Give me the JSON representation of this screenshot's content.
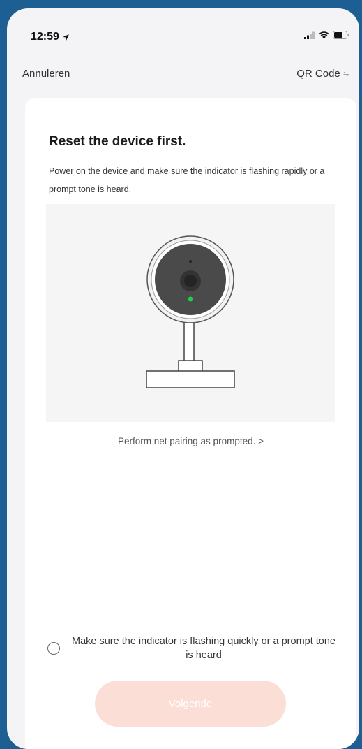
{
  "status_bar": {
    "time": "12:59"
  },
  "nav": {
    "cancel_label": "Annuleren",
    "qr_label": "QR Code"
  },
  "card": {
    "title": "Reset the device first.",
    "description": "Power on the device and make sure the indicator is flashing rapidly or a prompt tone is heard.",
    "pairing_link": "Perform net pairing as prompted. >",
    "confirm_text": "Make sure the indicator is flashing quickly or a prompt tone is heard",
    "confirm_checked": false,
    "next_label": "Volgende"
  },
  "colors": {
    "background": "#1d5f93",
    "screen": "#f4f4f6",
    "card": "#ffffff",
    "button_disabled": "#fbdfd6",
    "indicator_led": "#22cc44"
  },
  "icons": {
    "location": "location-arrow-icon",
    "signal": "signal-icon",
    "wifi": "wifi-icon",
    "battery": "battery-icon",
    "qr": "qr-switch-icon",
    "camera": "camera-illustration"
  }
}
